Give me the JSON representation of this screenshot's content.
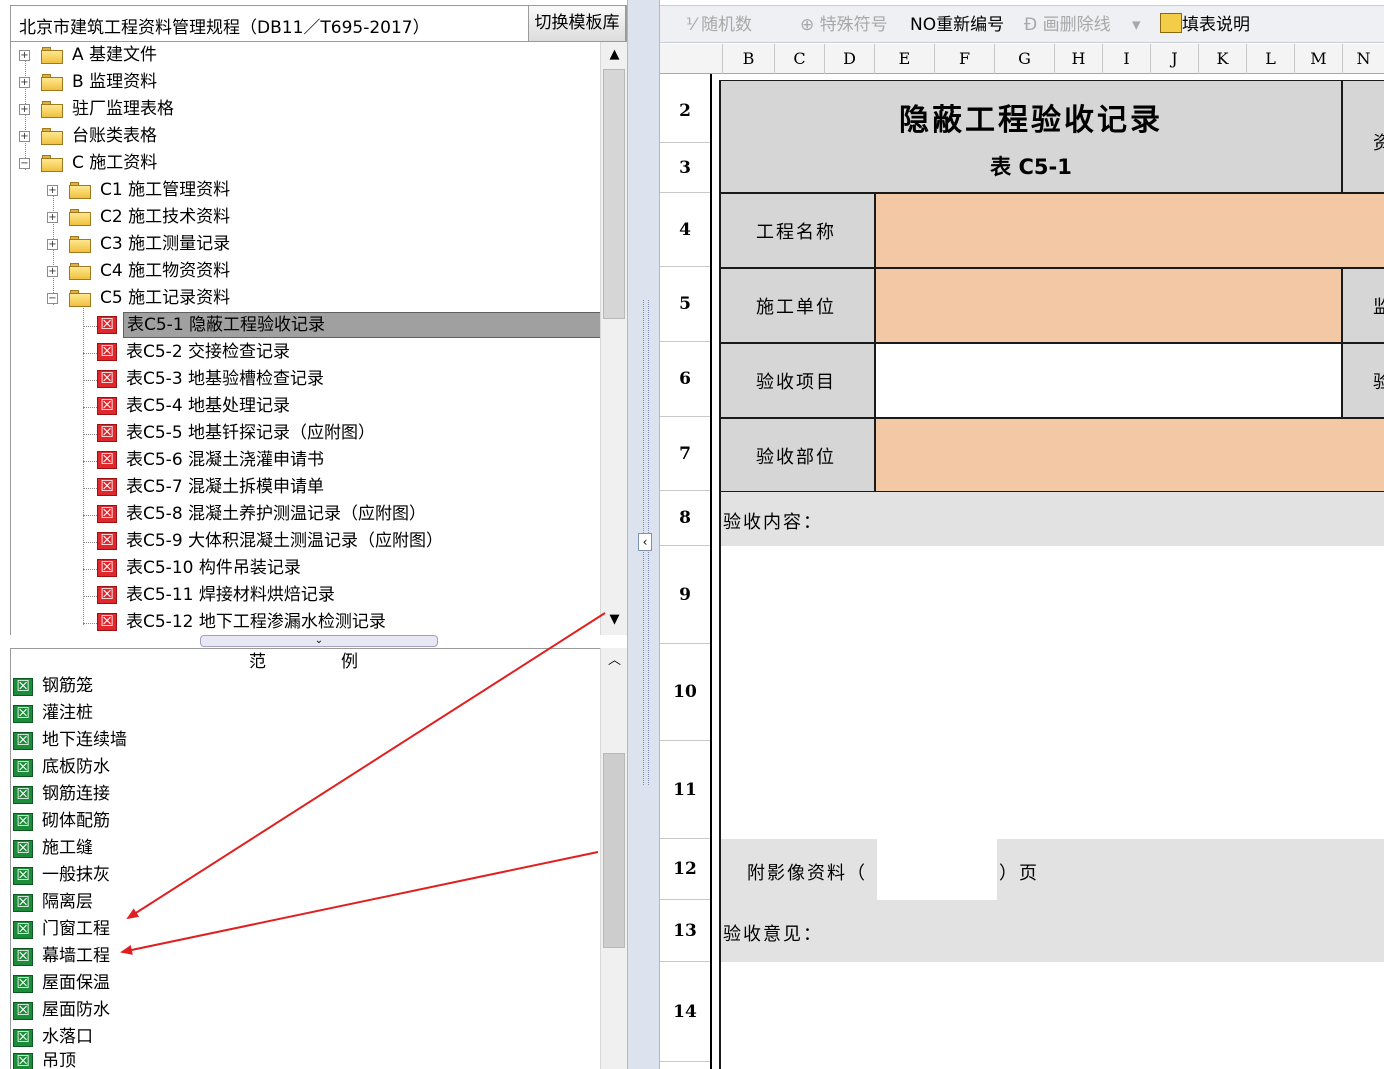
{
  "left_panel": {
    "title": "北京市建筑工程资料管理规程（DB11／T695-2017）",
    "switch_button": "切换模板库",
    "tree": [
      {
        "label": "A 基建文件",
        "expanded": false,
        "level": 0
      },
      {
        "label": "B 监理资料",
        "expanded": false,
        "level": 0
      },
      {
        "label": "驻厂监理表格",
        "expanded": false,
        "level": 0
      },
      {
        "label": "台账类表格",
        "expanded": false,
        "level": 0
      },
      {
        "label": "C 施工资料",
        "expanded": true,
        "level": 0
      },
      {
        "label": "C1 施工管理资料",
        "expanded": false,
        "level": 1
      },
      {
        "label": "C2 施工技术资料",
        "expanded": false,
        "level": 1
      },
      {
        "label": "C3 施工测量记录",
        "expanded": false,
        "level": 1
      },
      {
        "label": "C4 施工物资资料",
        "expanded": false,
        "level": 1
      },
      {
        "label": "C5 施工记录资料",
        "expanded": true,
        "level": 1
      },
      {
        "label": "表C5-1 隐蔽工程验收记录",
        "level": 2,
        "selected": true
      },
      {
        "label": "表C5-2 交接检查记录",
        "level": 2
      },
      {
        "label": "表C5-3 地基验槽检查记录",
        "level": 2
      },
      {
        "label": "表C5-4 地基处理记录",
        "level": 2
      },
      {
        "label": "表C5-5 地基钎探记录（应附图）",
        "level": 2
      },
      {
        "label": "表C5-6 混凝土浇灌申请书",
        "level": 2
      },
      {
        "label": "表C5-7 混凝土拆模申请单",
        "level": 2
      },
      {
        "label": "表C5-8 混凝土养护测温记录（应附图）",
        "level": 2
      },
      {
        "label": "表C5-9 大体积混凝土测温记录（应附图）",
        "level": 2
      },
      {
        "label": "表C5-10 构件吊装记录",
        "level": 2
      },
      {
        "label": "表C5-11 焊接材料烘焙记录",
        "level": 2
      },
      {
        "label": "表C5-12 地下工程渗漏水检测记录",
        "level": 2
      }
    ],
    "examples_header": [
      "范",
      "例"
    ],
    "examples": [
      "钢筋笼",
      "灌注桩",
      "地下连续墙",
      "底板防水",
      "钢筋连接",
      "砌体配筋",
      "施工缝",
      "一般抹灰",
      "隔离层",
      "门窗工程",
      "幕墙工程",
      "屋面保温",
      "屋面防水",
      "水落口",
      "吊顶"
    ]
  },
  "toolbar": {
    "random": "随机数",
    "special": "特殊符号",
    "renumber": "NO重新编号",
    "delete_line": "画删除线",
    "fill_help": "填表说明"
  },
  "columns": [
    "B",
    "C",
    "D",
    "E",
    "F",
    "G",
    "H",
    "I",
    "J",
    "K",
    "L",
    "M",
    "N"
  ],
  "rows": [
    "2",
    "3",
    "4",
    "5",
    "6",
    "7",
    "8",
    "9",
    "10",
    "11",
    "12",
    "13",
    "14"
  ],
  "form": {
    "title": "隐蔽工程验收记录",
    "subtitle": "表 C5-1",
    "right_title_fragment": "资",
    "project_name_label": "工程名称",
    "construction_unit_label": "施工单位",
    "supervision_fragment": "监",
    "acceptance_item_label": "验收项目",
    "acceptance_item_fragment": "验",
    "acceptance_part_label": "验收部位",
    "content_label": "验收内容：",
    "attach_label": "附影像资料（",
    "attach_suffix": "）页",
    "opinion_label": "验收意见："
  },
  "colors": {
    "input_cell": "#f2c9a4",
    "label_cell": "#d6d6d6",
    "annotation_arrow": "#e02020"
  }
}
